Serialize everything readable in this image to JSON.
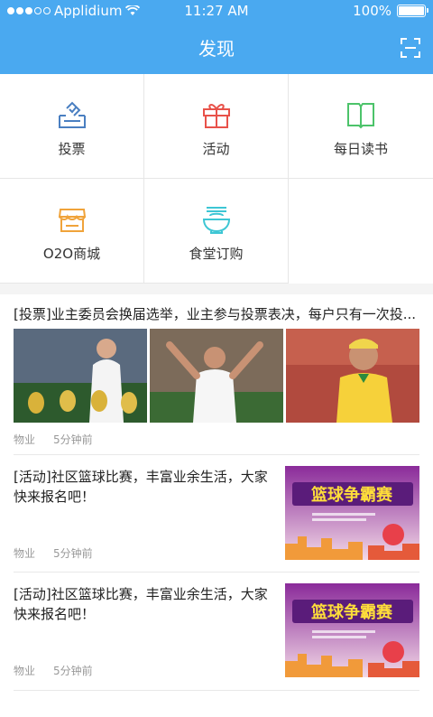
{
  "status_bar": {
    "carrier": "Applidium",
    "time": "11:27 AM",
    "battery": "100%"
  },
  "header": {
    "title": "发现",
    "scan_icon": "scan-icon"
  },
  "features": [
    {
      "label": "投票",
      "icon": "vote-icon",
      "color": "#4a7fc1"
    },
    {
      "label": "活动",
      "icon": "gift-icon",
      "color": "#e8524a"
    },
    {
      "label": "每日读书",
      "icon": "book-icon",
      "color": "#4cc36a"
    },
    {
      "label": "O2O商城",
      "icon": "store-icon",
      "color": "#f0a33a"
    },
    {
      "label": "食堂订购",
      "icon": "bowl-icon",
      "color": "#3dc6d4"
    }
  ],
  "articles": [
    {
      "title": "[投票]业主委员会换届选举，业主参与投票表决，每户只有一次投...",
      "source": "物业",
      "time": "5分钟前"
    },
    {
      "title": "[活动]社区篮球比赛，丰富业余生活，大家快来报名吧！",
      "source": "物业",
      "time": "5分钟前",
      "banner_text": "篮球争霸赛"
    },
    {
      "title": "[活动]社区篮球比赛，丰富业余生活，大家快来报名吧！",
      "source": "物业",
      "time": "5分钟前",
      "banner_text": "篮球争霸赛"
    }
  ],
  "colors": {
    "primary": "#4aa9f0"
  }
}
